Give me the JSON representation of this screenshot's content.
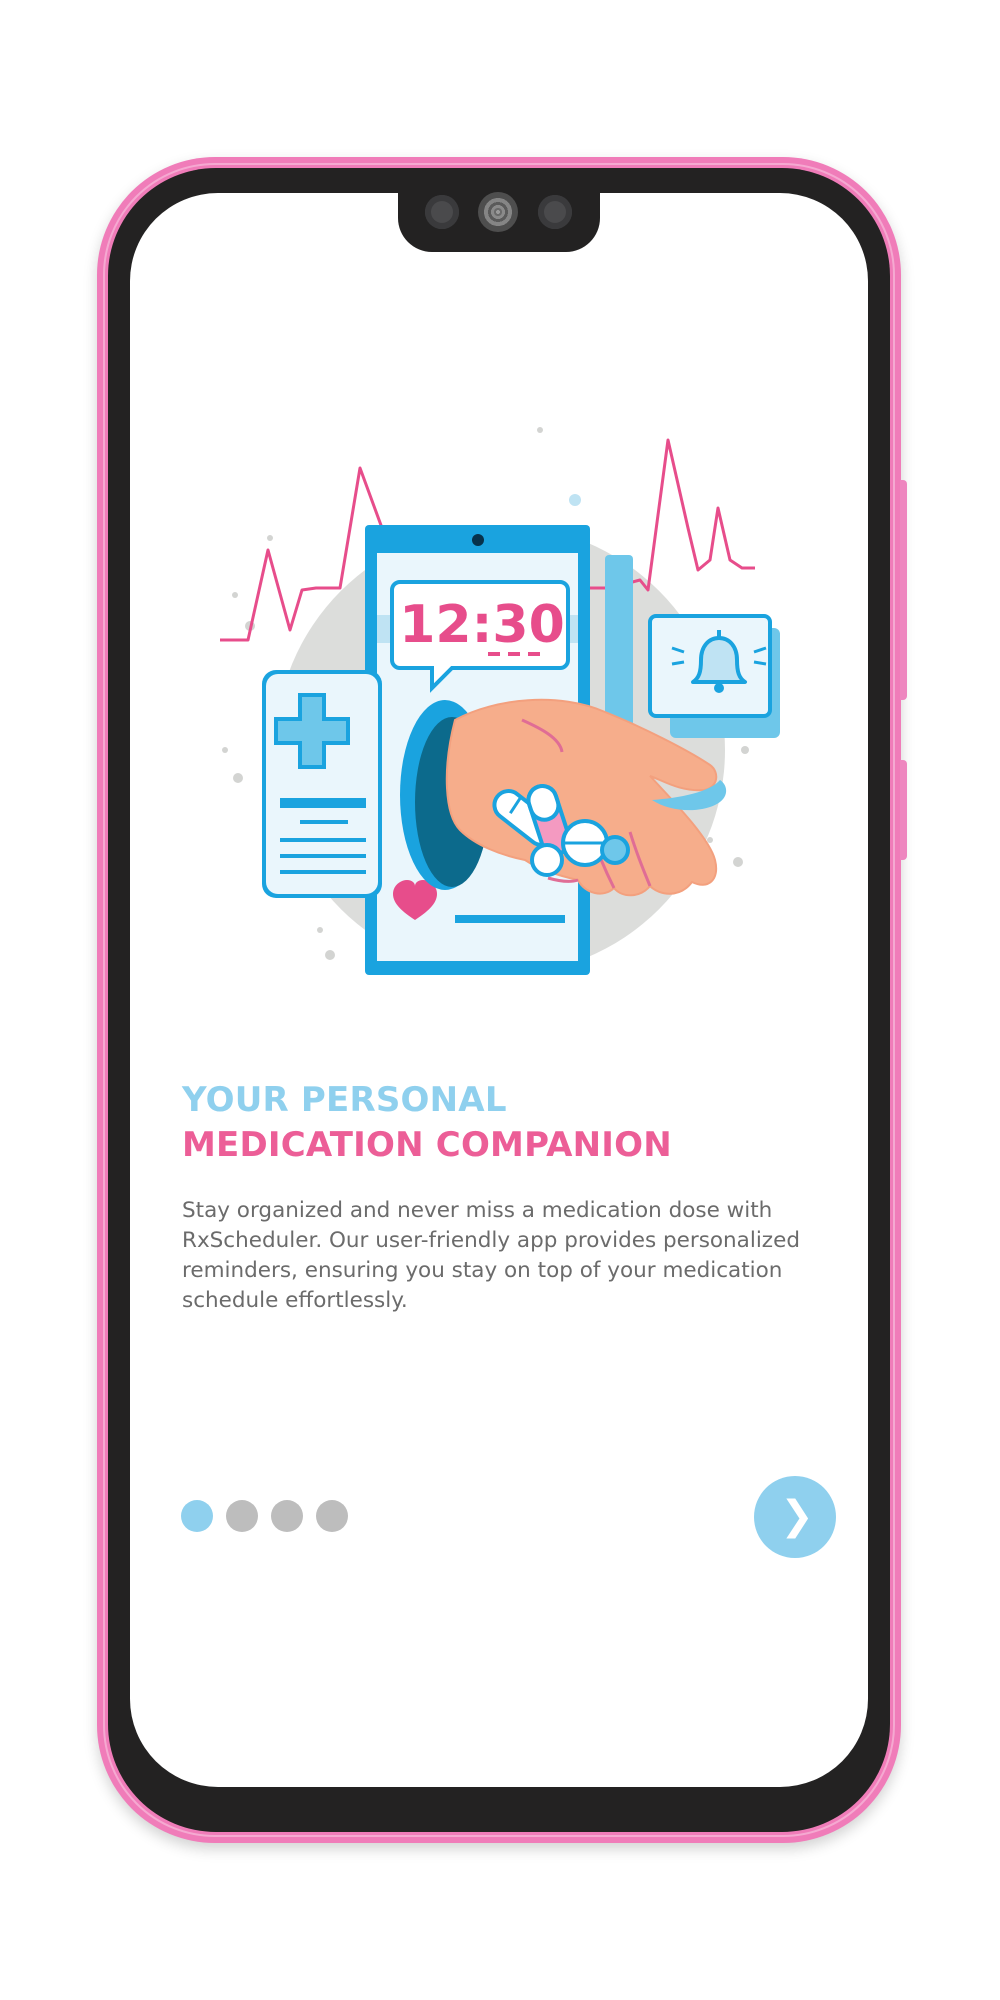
{
  "onboarding": {
    "clock_display": "12:30",
    "title_line1": "YOUR PERSONAL",
    "title_line2": "MEDICATION COMPANION",
    "description": "Stay organized and never miss a medication dose with RxScheduler. Our user-friendly app provides personalized reminders, ensuring you stay on top of your medication schedule effortlessly.",
    "next_icon": "chevron-right-icon",
    "next_glyph": "❯"
  },
  "pager": {
    "total_pages": 4,
    "current_page": 1
  },
  "colors": {
    "phone_frame": "#f07cb9",
    "bezel": "#232222",
    "accent_blue": "#8fd0ee",
    "accent_pink": "#ec5e97",
    "body_text": "#6b6b6b",
    "dot_inactive": "#bdbdbd",
    "illustration_blue": "#1aa3df"
  }
}
